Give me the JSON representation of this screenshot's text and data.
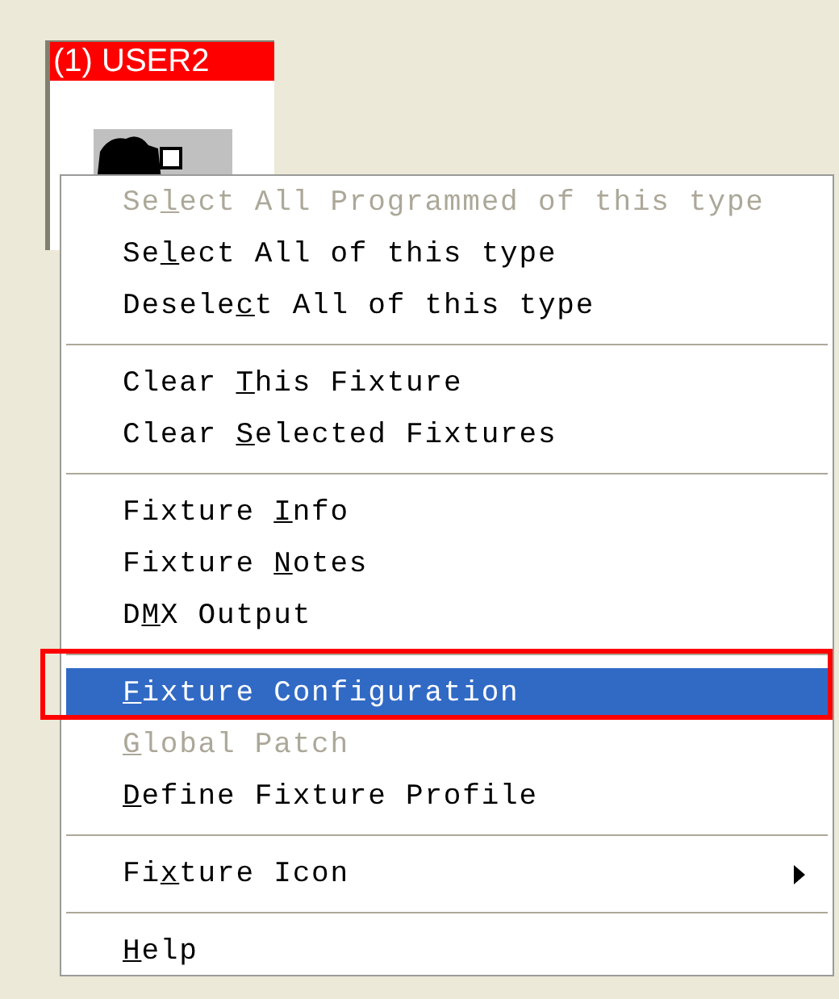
{
  "fixture_tile": {
    "title": "(1) USER2"
  },
  "menu": {
    "groups": [
      {
        "items": [
          {
            "parts": [
              {
                "text": "Se",
                "underline": false
              },
              {
                "text": "l",
                "underline": true
              },
              {
                "text": "ect All Programmed of this type",
                "underline": false
              }
            ],
            "disabled": true,
            "selected": false,
            "submenu": false
          },
          {
            "parts": [
              {
                "text": "Se",
                "underline": false
              },
              {
                "text": "l",
                "underline": true
              },
              {
                "text": "ect All of this type",
                "underline": false
              }
            ],
            "disabled": false,
            "selected": false,
            "submenu": false
          },
          {
            "parts": [
              {
                "text": "Desele",
                "underline": false
              },
              {
                "text": "c",
                "underline": true
              },
              {
                "text": "t All of this type",
                "underline": false
              }
            ],
            "disabled": false,
            "selected": false,
            "submenu": false
          }
        ]
      },
      {
        "items": [
          {
            "parts": [
              {
                "text": "Clear ",
                "underline": false
              },
              {
                "text": "T",
                "underline": true
              },
              {
                "text": "his Fixture",
                "underline": false
              }
            ],
            "disabled": false,
            "selected": false,
            "submenu": false
          },
          {
            "parts": [
              {
                "text": "Clear ",
                "underline": false
              },
              {
                "text": "S",
                "underline": true
              },
              {
                "text": "elected Fixtures",
                "underline": false
              }
            ],
            "disabled": false,
            "selected": false,
            "submenu": false
          }
        ]
      },
      {
        "items": [
          {
            "parts": [
              {
                "text": "Fixture ",
                "underline": false
              },
              {
                "text": "I",
                "underline": true
              },
              {
                "text": "nfo",
                "underline": false
              }
            ],
            "disabled": false,
            "selected": false,
            "submenu": false
          },
          {
            "parts": [
              {
                "text": "Fixture ",
                "underline": false
              },
              {
                "text": "N",
                "underline": true
              },
              {
                "text": "otes",
                "underline": false
              }
            ],
            "disabled": false,
            "selected": false,
            "submenu": false
          },
          {
            "parts": [
              {
                "text": "D",
                "underline": false
              },
              {
                "text": "M",
                "underline": true
              },
              {
                "text": "X Output",
                "underline": false
              }
            ],
            "disabled": false,
            "selected": false,
            "submenu": false
          }
        ]
      },
      {
        "items": [
          {
            "parts": [
              {
                "text": "F",
                "underline": true
              },
              {
                "text": "ixture Configuration",
                "underline": false
              }
            ],
            "disabled": false,
            "selected": true,
            "submenu": false
          },
          {
            "parts": [
              {
                "text": "G",
                "underline": true
              },
              {
                "text": "lobal Patch",
                "underline": false
              }
            ],
            "disabled": true,
            "selected": false,
            "submenu": false
          },
          {
            "parts": [
              {
                "text": "D",
                "underline": true
              },
              {
                "text": "efine Fixture Profile",
                "underline": false
              }
            ],
            "disabled": false,
            "selected": false,
            "submenu": false
          }
        ]
      },
      {
        "items": [
          {
            "parts": [
              {
                "text": "Fi",
                "underline": false
              },
              {
                "text": "x",
                "underline": true
              },
              {
                "text": "ture Icon",
                "underline": false
              }
            ],
            "disabled": false,
            "selected": false,
            "submenu": true
          }
        ]
      },
      {
        "items": [
          {
            "parts": [
              {
                "text": "H",
                "underline": true
              },
              {
                "text": "elp",
                "underline": false
              }
            ],
            "disabled": false,
            "selected": false,
            "submenu": false
          }
        ]
      }
    ]
  }
}
